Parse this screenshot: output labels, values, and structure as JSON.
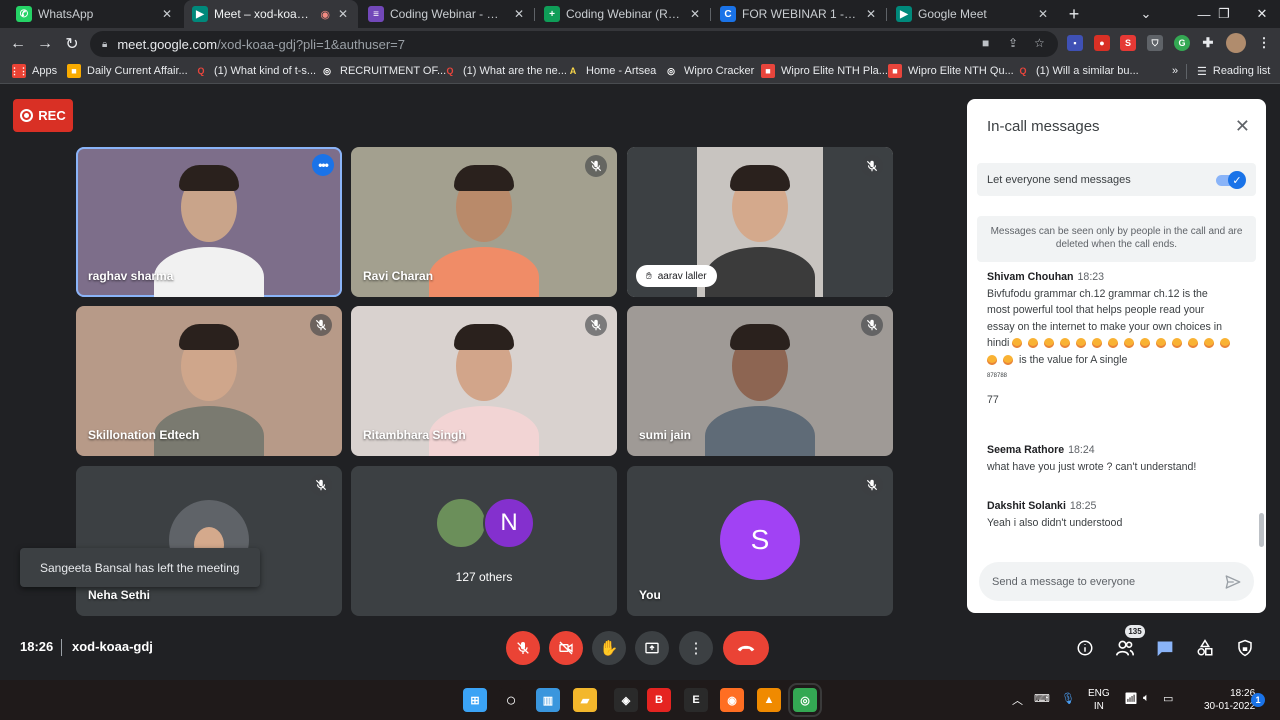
{
  "browser": {
    "tabs": [
      {
        "title": "WhatsApp",
        "icon": "whatsapp-icon",
        "color": "#25d366",
        "glyph": "✆"
      },
      {
        "title": "Meet – xod-koaa-gdj",
        "icon": "google-meet-icon",
        "color": "#00897b",
        "glyph": "▶",
        "active": true
      },
      {
        "title": "Coding Webinar - Google F",
        "icon": "google-forms-icon",
        "color": "#7248b9",
        "glyph": "≡"
      },
      {
        "title": "Coding Webinar (Response",
        "icon": "google-sheets-icon",
        "color": "#0f9d58",
        "glyph": "+"
      },
      {
        "title": "FOR WEBINAR 1 - Presenta",
        "icon": "canva-icon",
        "color": "#1a73e8",
        "glyph": "C"
      },
      {
        "title": "Google Meet",
        "icon": "google-meet-icon",
        "color": "#00897b",
        "glyph": "▶"
      }
    ],
    "new_tab": "+",
    "url_host": "meet.google.com",
    "url_path": "/xod-koaa-gdj?pli=1&authuser=7",
    "bookmarks": [
      {
        "label": "Apps",
        "icon": "apps-grid-icon",
        "color": "#ea4335"
      },
      {
        "label": "Daily Current Affair...",
        "icon": "bookmark-favicon",
        "color": "#f9ab00"
      },
      {
        "label": "(1) What kind of t-s...",
        "icon": "quora-icon",
        "color": "#b92b27"
      },
      {
        "label": "RECRUITMENT OF...",
        "icon": "globe-icon",
        "color": "#5f6368"
      },
      {
        "label": "(1) What are the ne...",
        "icon": "quora-icon",
        "color": "#b92b27"
      },
      {
        "label": "Home - Artsea",
        "icon": "artsea-icon",
        "color": "#202124"
      },
      {
        "label": "Wipro Cracker",
        "icon": "globe-icon",
        "color": "#5f6368"
      },
      {
        "label": "Wipro Elite NTH Pla...",
        "icon": "bookmark-favicon",
        "color": "#e8453c"
      },
      {
        "label": "Wipro Elite NTH Qu...",
        "icon": "bookmark-favicon",
        "color": "#e8453c"
      },
      {
        "label": "(1) Will a similar bu...",
        "icon": "quora-icon",
        "color": "#b92b27"
      }
    ],
    "more_bookmarks": "»",
    "reading_list": "Reading list"
  },
  "meet": {
    "rec_label": "REC",
    "tiles": [
      {
        "name": "raghav sharma",
        "bg": "#7d6e8a",
        "skin": "#c9a48a",
        "shirt": "#f1f1f1",
        "state": "options"
      },
      {
        "name": "Ravi Charan",
        "bg": "#a3a08f",
        "skin": "#b98a6a",
        "shirt": "#f08c67",
        "state": "muted"
      },
      {
        "name": "aarav laller",
        "bg": "#c8c4c0",
        "skin": "#d4a98c",
        "shirt": "#3b3b3b",
        "state": "muted-hand"
      },
      {
        "name": "Skillonation Edtech",
        "bg": "#b79a88",
        "skin": "#cfa68b",
        "shirt": "#7a7a70",
        "state": "muted"
      },
      {
        "name": "Ritambhara Singh",
        "bg": "#d9d2cf",
        "skin": "#d2a58a",
        "shirt": "#f2d4d4",
        "state": "muted"
      },
      {
        "name": "sumi jain",
        "bg": "#9f9a96",
        "skin": "#8d6552",
        "shirt": "#5f6b77",
        "state": "muted"
      },
      {
        "name": "Neha Sethi",
        "state": "muted-avatar"
      },
      {
        "name": "127 others",
        "initial": "N",
        "state": "others"
      },
      {
        "name": "You",
        "initial": "S",
        "state": "muted-self"
      }
    ],
    "toast": "Sangeeta Bansal has left the meeting",
    "time": "18:26",
    "meeting_code": "xod-koaa-gdj",
    "participant_count": "135",
    "accent": "#1a73e8",
    "danger": "#ea4335"
  },
  "chat": {
    "title": "In-call messages",
    "setting_label": "Let everyone send messages",
    "setting_on": true,
    "notice": "Messages can be seen only by people in the call and are deleted when the call ends.",
    "messages": [
      {
        "sender": "Shivam Chouhan",
        "time": "18:23",
        "lines": [
          "Bivfufodu grammar ch.12 grammar ch.12 is the",
          "most powerful tool that helps people read your",
          "essay on the internet to make your own choices in"
        ],
        "emoji_line_prefix": "hindi",
        "emoji_count_first_line": 14,
        "emoji_count_second_line": 2,
        "emoji_line_suffix": "is the value for A single",
        "extra_small": "878788",
        "extra": "77"
      },
      {
        "sender": "Seema Rathore",
        "time": "18:24",
        "text": "what have you just wrote ? can't understand!"
      },
      {
        "sender": "Dakshit Solanki",
        "time": "18:25",
        "text": "Yeah i also didn't understood"
      }
    ],
    "compose_placeholder": "Send a message to everyone"
  },
  "taskbar": {
    "apps": [
      {
        "icon": "windows-start-icon",
        "color": "#3ba3f5"
      },
      {
        "icon": "search-icon",
        "color": "#1f1a1a"
      },
      {
        "icon": "task-view-icon",
        "color": "#3a96dd"
      },
      {
        "icon": "file-explorer-icon",
        "color": "#f3b72c"
      },
      {
        "icon": "predator-sense-icon",
        "color": "#2a2a2a"
      },
      {
        "icon": "bitdefender-icon",
        "color": "#e52421"
      },
      {
        "icon": "epic-games-icon",
        "color": "#2a2a2a"
      },
      {
        "icon": "firefox-icon",
        "color": "#ff6e22"
      },
      {
        "icon": "vlc-icon",
        "color": "#f08a00"
      },
      {
        "icon": "chrome-icon",
        "color": "#34a853"
      }
    ],
    "lang_1": "ENG",
    "lang_2": "IN",
    "clock_time": "18:26",
    "clock_date": "30-01-2022"
  }
}
